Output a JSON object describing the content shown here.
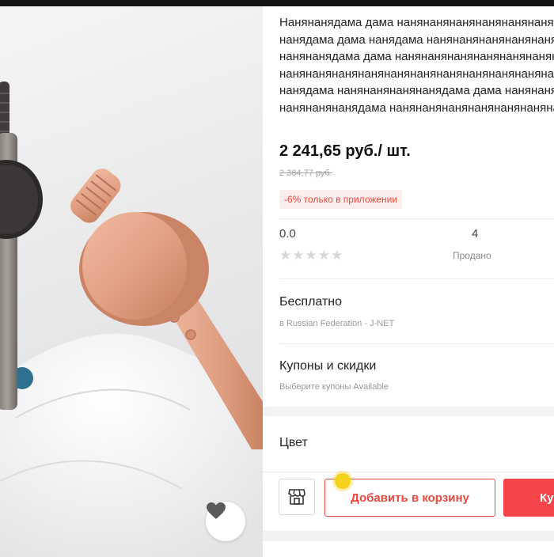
{
  "product": {
    "title_lines": [
      "Нанянанядама дама нанянанянанянанянанянанянанянанянаняна",
      "нанядама дама нанядама нанянанянанянанянанянанянанянанянаня",
      "нанянанядама дама нанянанянанянанянанянанянанянанянанянаня",
      "нанянанянанянанянанянанянанянанянанянанянанянанянанянаняна",
      "нанядама нанянанянанянанядама дама нанянанянанянанянанянаня",
      "нанянанянанядама нанянанянанянанянанянанянанянанянанянаняна"
    ],
    "price": "2 241,65 руб./ шт.",
    "old_price": "2 384,77 руб.",
    "promo": "-6% только в приложении"
  },
  "stats": {
    "rating": "0.0",
    "stars": "★★★★★",
    "sold_count": "4",
    "sold_label": "Продано"
  },
  "shipping": {
    "title": "Бесплатно",
    "subtitle": "в Russian Federation - J-NET"
  },
  "coupons": {
    "title": "Купоны и скидки",
    "subtitle": "Выберите купоны Available"
  },
  "color": {
    "title": "Цвет"
  },
  "actions": {
    "add_to_cart": "Добавить в корзину",
    "buy_now": "Купить"
  },
  "icons": {
    "favorite": "heart-icon",
    "store": "store-icon"
  },
  "colors": {
    "accent": "#e8483e",
    "buy_button": "#f5444a",
    "promo_bg": "#fdeeee",
    "touch_indicator": "#f6d21c"
  }
}
